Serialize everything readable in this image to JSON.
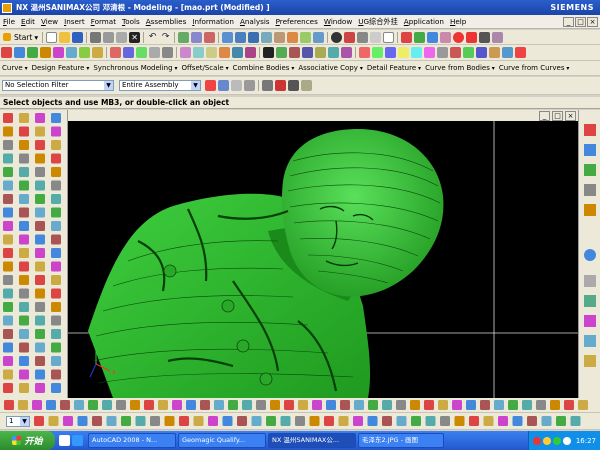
{
  "window": {
    "title": "NX 温州SANIMAX公司 邓清根 - Modeling - [mao.prt (Modified) ]",
    "brand": "SIEMENS"
  },
  "menu": [
    "File",
    "Edit",
    "View",
    "Insert",
    "Format",
    "Tools",
    "Assemblies",
    "Information",
    "Analysis",
    "Preferences",
    "Window",
    "UG综合外挂",
    "Application",
    "Help"
  ],
  "toolbar": {
    "start_label": "Start"
  },
  "features": [
    "Curve",
    "Design Feature",
    "Synchronous Modeling",
    "Offset/Scale",
    "Combine Bodies",
    "Associative Copy",
    "Detail Feature",
    "Curve from Bodies",
    "Curve from Curves"
  ],
  "selection": {
    "filter": "No Selection Filter",
    "scope": "Entire Assembly"
  },
  "status": "Select objects and use MB3, or double-click an object",
  "bottom": {
    "layer_value": "1"
  },
  "taskbar": {
    "start": "开始",
    "tasks": [
      "AutoCAD 2008 - N...",
      "Geomagic Qualify...",
      "NX 温州SANIMAX公...",
      "毛泽东2.JPG - 画图"
    ],
    "active_index": 2,
    "clock": "16:27"
  },
  "colors": {
    "model": "#2fb52f",
    "viewport": "#000000",
    "accent": "#2457d0"
  }
}
